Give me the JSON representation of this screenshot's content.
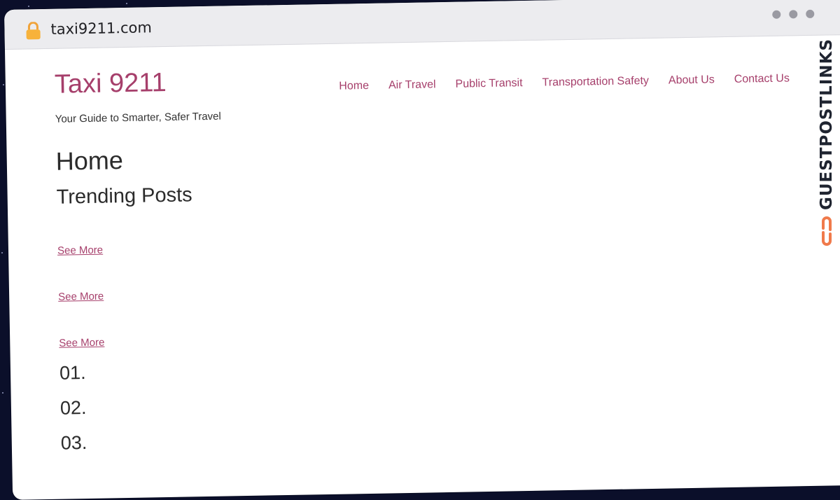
{
  "browser": {
    "url": "taxi9211.com",
    "lock_icon": "lock-icon",
    "window_controls": [
      "dot",
      "dot",
      "dot"
    ]
  },
  "site": {
    "title": "Taxi 9211",
    "tagline": "Your Guide to Smarter, Safer Travel",
    "accent_color": "#a63f6b"
  },
  "nav": {
    "items": [
      {
        "label": "Home"
      },
      {
        "label": "Air Travel"
      },
      {
        "label": "Public Transit"
      },
      {
        "label": "Transportation Safety"
      },
      {
        "label": "About Us"
      },
      {
        "label": "Contact Us"
      }
    ]
  },
  "main": {
    "page_title": "Home",
    "section_title": "Trending Posts",
    "see_more": [
      "See More",
      "See More",
      "See More"
    ],
    "numbers": [
      "01.",
      "02.",
      "03."
    ]
  },
  "sidebar_brand": {
    "text": "GUESTPOSTLINKS",
    "icon": "chain-link-icon",
    "icon_color": "#f07a4b"
  }
}
